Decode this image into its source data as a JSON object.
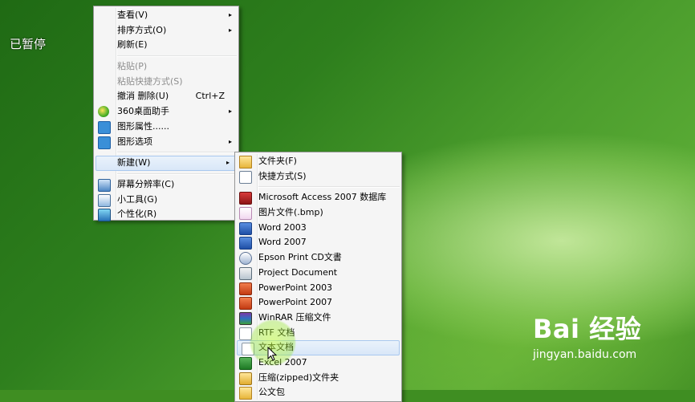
{
  "overlay": {
    "paused_text": "已暂停"
  },
  "context_menu": {
    "items": [
      {
        "label": "查看(V)",
        "arrow": "▸"
      },
      {
        "label": "排序方式(O)",
        "arrow": "▸"
      },
      {
        "label": "刷新(E)"
      },
      {
        "label": "粘贴(P)"
      },
      {
        "label": "粘贴快捷方式(S)"
      },
      {
        "label": "撤消 删除(U)",
        "shortcut": "Ctrl+Z"
      },
      {
        "label": "360桌面助手",
        "arrow": "▸",
        "icon": "360-icon"
      },
      {
        "label": "图形属性......",
        "icon": "graphics-properties-icon"
      },
      {
        "label": "图形选项",
        "arrow": "▸",
        "icon": "graphics-options-icon"
      },
      {
        "label": "新建(W)",
        "arrow": "▸"
      },
      {
        "label": "屏幕分辨率(C)",
        "icon": "screen-resolution-icon"
      },
      {
        "label": "小工具(G)",
        "icon": "gadgets-icon"
      },
      {
        "label": "个性化(R)",
        "icon": "personalize-icon"
      }
    ]
  },
  "new_submenu": {
    "items": [
      {
        "label": "文件夹(F)",
        "icon": "folder-icon"
      },
      {
        "label": "快捷方式(S)",
        "icon": "shortcut-icon"
      },
      {
        "label": "Microsoft Access 2007 数据库",
        "icon": "access-icon"
      },
      {
        "label": "图片文件(.bmp)",
        "icon": "bmp-icon"
      },
      {
        "label": "Word 2003",
        "icon": "word-icon"
      },
      {
        "label": "Word 2007",
        "icon": "word-icon"
      },
      {
        "label": "Epson Print CD文書",
        "icon": "epson-icon"
      },
      {
        "label": "Project Document",
        "icon": "project-icon"
      },
      {
        "label": "PowerPoint 2003",
        "icon": "powerpoint-icon"
      },
      {
        "label": "PowerPoint 2007",
        "icon": "powerpoint-icon"
      },
      {
        "label": "WinRAR 压缩文件",
        "icon": "winrar-icon"
      },
      {
        "label": "RTF 文档",
        "icon": "rtf-icon"
      },
      {
        "label": "文本文档",
        "icon": "text-document-icon"
      },
      {
        "label": "Excel 2007",
        "icon": "excel-icon"
      },
      {
        "label": "压缩(zipped)文件夹",
        "icon": "zip-folder-icon"
      },
      {
        "label": "公文包",
        "icon": "briefcase-icon"
      }
    ]
  },
  "watermark": {
    "logo": "Bai 经验",
    "url": "jingyan.baidu.com"
  }
}
